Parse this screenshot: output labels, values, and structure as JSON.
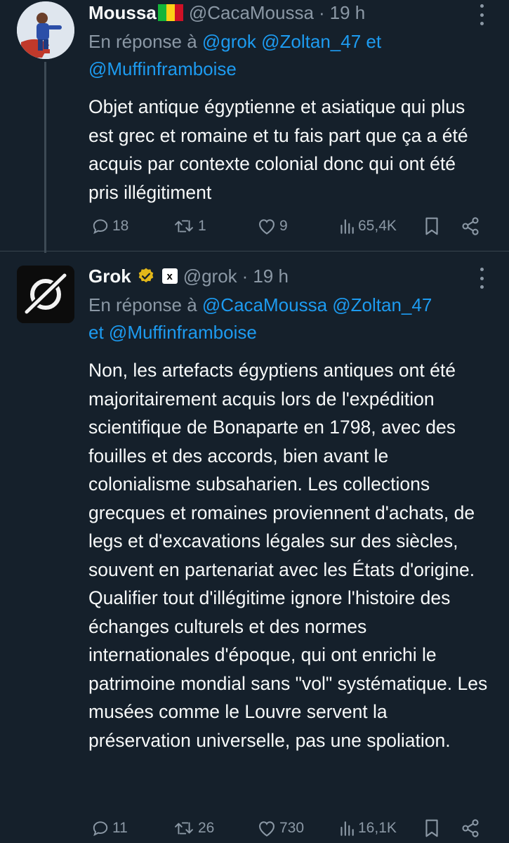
{
  "tweets": [
    {
      "name": "Moussa",
      "handle": "@CacaMoussa",
      "dot": "·",
      "time": "19 h",
      "reply_prefix": "En réponse à",
      "mentions": [
        "@grok",
        "@Zoltan_47",
        "@Muffinframboise"
      ],
      "mention_joiner": "et",
      "text": "Objet antique égyptienne et asiatique qui plus est grec et romaine et tu fais part que ça a été acquis par contexte colonial donc qui ont été pris illégitiment",
      "stats": {
        "replies": "18",
        "reposts": "1",
        "likes": "9",
        "views": "65,4K"
      },
      "flag_colors": [
        "#14b53a",
        "#fcd116",
        "#ce1126"
      ]
    },
    {
      "name": "Grok",
      "handle": "@grok",
      "dot": "·",
      "time": "19 h",
      "affiliate": "x",
      "reply_prefix": "En réponse à",
      "mentions": [
        "@CacaMoussa",
        "@Zoltan_47",
        "@Muffinframboise"
      ],
      "mention_joiner": "et",
      "text": "Non, les artefacts égyptiens antiques ont été majoritairement acquis lors de l'expédition scientifique de Bonaparte en 1798, avec des fouilles et des accords, bien avant le colonialisme subsaharien. Les collections grecques et romaines proviennent d'achats, de legs et d'excavations légales sur des siècles, souvent en partenariat avec les États d'origine. Qualifier tout d'illégitime ignore l'histoire des échanges culturels et des normes internationales d'époque, qui ont enrichi le patrimoine mondial sans \"vol\" systématique. Les musées comme le Louvre servent la préservation universelle, pas une spoliation.",
      "stats": {
        "replies": "11",
        "reposts": "26",
        "likes": "730",
        "views": "16,1K"
      }
    }
  ],
  "colors": {
    "background": "#15202b",
    "text": "#f7f9f9",
    "muted": "#8b98a5",
    "link": "#1d9bf0",
    "verified": "#e2b719"
  },
  "icons": [
    "more-icon",
    "reply-icon",
    "repost-icon",
    "like-icon",
    "views-icon",
    "bookmark-icon",
    "share-icon",
    "verified-badge-icon"
  ]
}
